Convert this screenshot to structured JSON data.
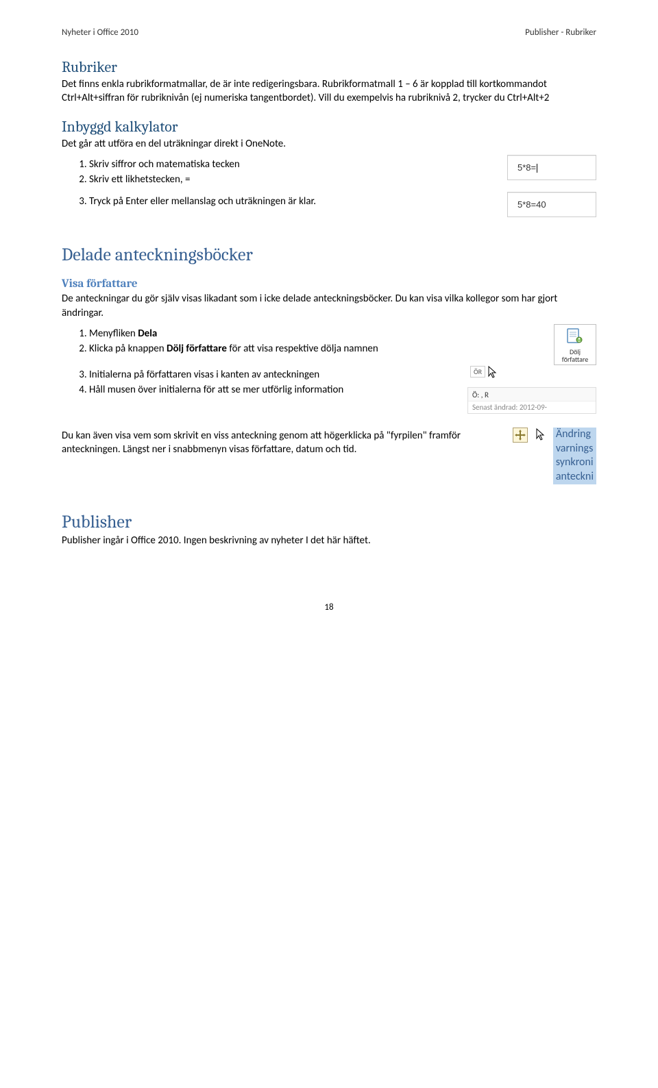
{
  "header": {
    "left": "Nyheter i Office 2010",
    "right": "Publisher - Rubriker"
  },
  "rubriker": {
    "title": "Rubriker",
    "p1": "Det finns enkla rubrikformatmallar, de är inte redigeringsbara. Rubrikformatmall 1 – 6 är kopplad till kortkommandot Ctrl+Alt+siffran för rubriknivån (ej numeriska tangentbordet). Vill du exempelvis ha rubriknivå 2, trycker du Ctrl+Alt+2"
  },
  "kalkylator": {
    "title": "Inbyggd kalkylator",
    "p1": "Det går att utföra en del uträkningar direkt i OneNote.",
    "steps_a": [
      "Skriv siffror och matematiska tecken",
      "Skriv ett likhetstecken, ="
    ],
    "steps_b": [
      "Tryck på Enter eller mellanslag och uträkningen är klar."
    ],
    "calc1": "5*8=",
    "calc2": "5*8=40"
  },
  "delade": {
    "title": "Delade anteckningsböcker",
    "visa": {
      "title": "Visa författare",
      "p1": "De anteckningar du gör själv visas likadant som i icke delade anteckningsböcker. Du kan visa vilka kollegor som har gjort ändringar.",
      "steps_a_prefix1": "Menyfliken ",
      "steps_a_bold1": "Dela",
      "steps_a_prefix2": "Klicka på knappen ",
      "steps_a_bold2": "Dölj författare",
      "steps_a_suffix2": " för att visa respektive dölja namnen",
      "steps_b": [
        "Initialerna på författaren visas i kanten av anteckningen",
        "Håll musen över initialerna för att se mer utförlig information"
      ],
      "dolj_label": "Dölj författare",
      "author_tag": "ÖR",
      "author_line": "Ö:        , R",
      "author_modified": "Senast ändrad: 2012-09-",
      "p2": "Du kan även visa vem som skrivit en viss anteckning genom att högerklicka på \"fyrpilen\" framför anteckningen. Längst ner i snabbmenyn visas författare, datum och tid.",
      "hl": [
        "Ändring",
        "varnings",
        "synkroni",
        "anteckni"
      ]
    }
  },
  "publisher": {
    "title": "Publisher",
    "p1": "Publisher ingår i Office 2010. Ingen beskrivning av nyheter I det här häftet."
  },
  "footer": {
    "page": "18"
  }
}
